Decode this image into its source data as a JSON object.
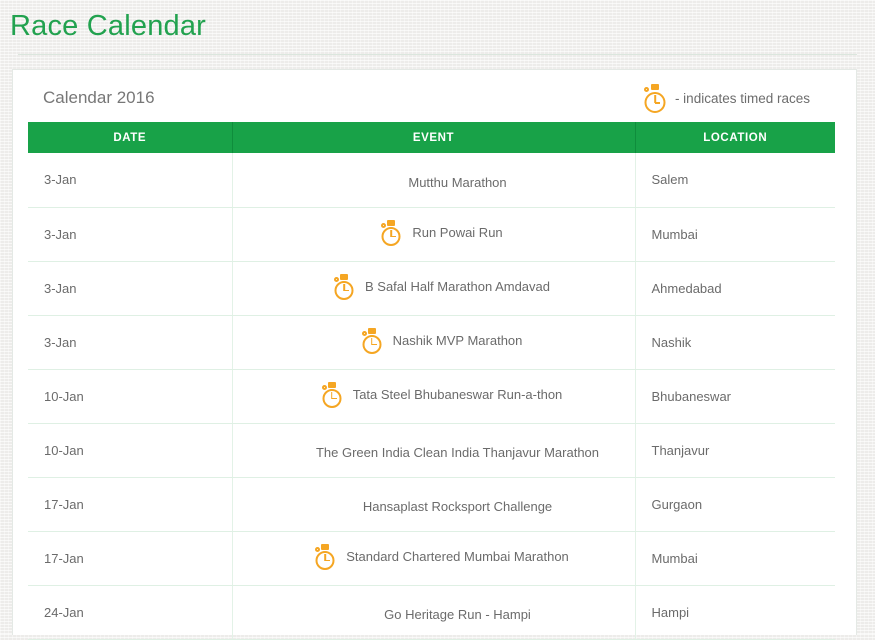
{
  "page": {
    "title": "Race Calendar",
    "accent_green": "#22a24f",
    "header_green": "#18a248",
    "icon_orange": "#f5a623",
    "text_gray": "#6b6b6b",
    "background": "#f2f1ef"
  },
  "card": {
    "subtitle": "Calendar 2016",
    "legend": {
      "icon": "stopwatch-icon",
      "text": "- indicates timed races"
    }
  },
  "table": {
    "columns": [
      "DATE",
      "EVENT",
      "LOCATION"
    ],
    "rows": [
      {
        "date": "3-Jan",
        "timed": false,
        "event": "Mutthu Marathon",
        "location": "Salem"
      },
      {
        "date": "3-Jan",
        "timed": true,
        "event": "Run Powai Run",
        "location": "Mumbai"
      },
      {
        "date": "3-Jan",
        "timed": true,
        "event": "B Safal Half Marathon Amdavad",
        "location": "Ahmedabad"
      },
      {
        "date": "3-Jan",
        "timed": true,
        "event": "Nashik MVP Marathon",
        "location": "Nashik"
      },
      {
        "date": "10-Jan",
        "timed": true,
        "event": "Tata Steel Bhubaneswar Run-a-thon",
        "location": "Bhubaneswar"
      },
      {
        "date": "10-Jan",
        "timed": false,
        "event": "The Green India Clean India Thanjavur Marathon",
        "location": "Thanjavur"
      },
      {
        "date": "17-Jan",
        "timed": false,
        "event": "Hansaplast Rocksport Challenge",
        "location": "Gurgaon"
      },
      {
        "date": "17-Jan",
        "timed": true,
        "event": "Standard Chartered Mumbai Marathon",
        "location": "Mumbai"
      },
      {
        "date": "24-Jan",
        "timed": false,
        "event": "Go Heritage Run - Hampi",
        "location": "Hampi"
      }
    ]
  }
}
